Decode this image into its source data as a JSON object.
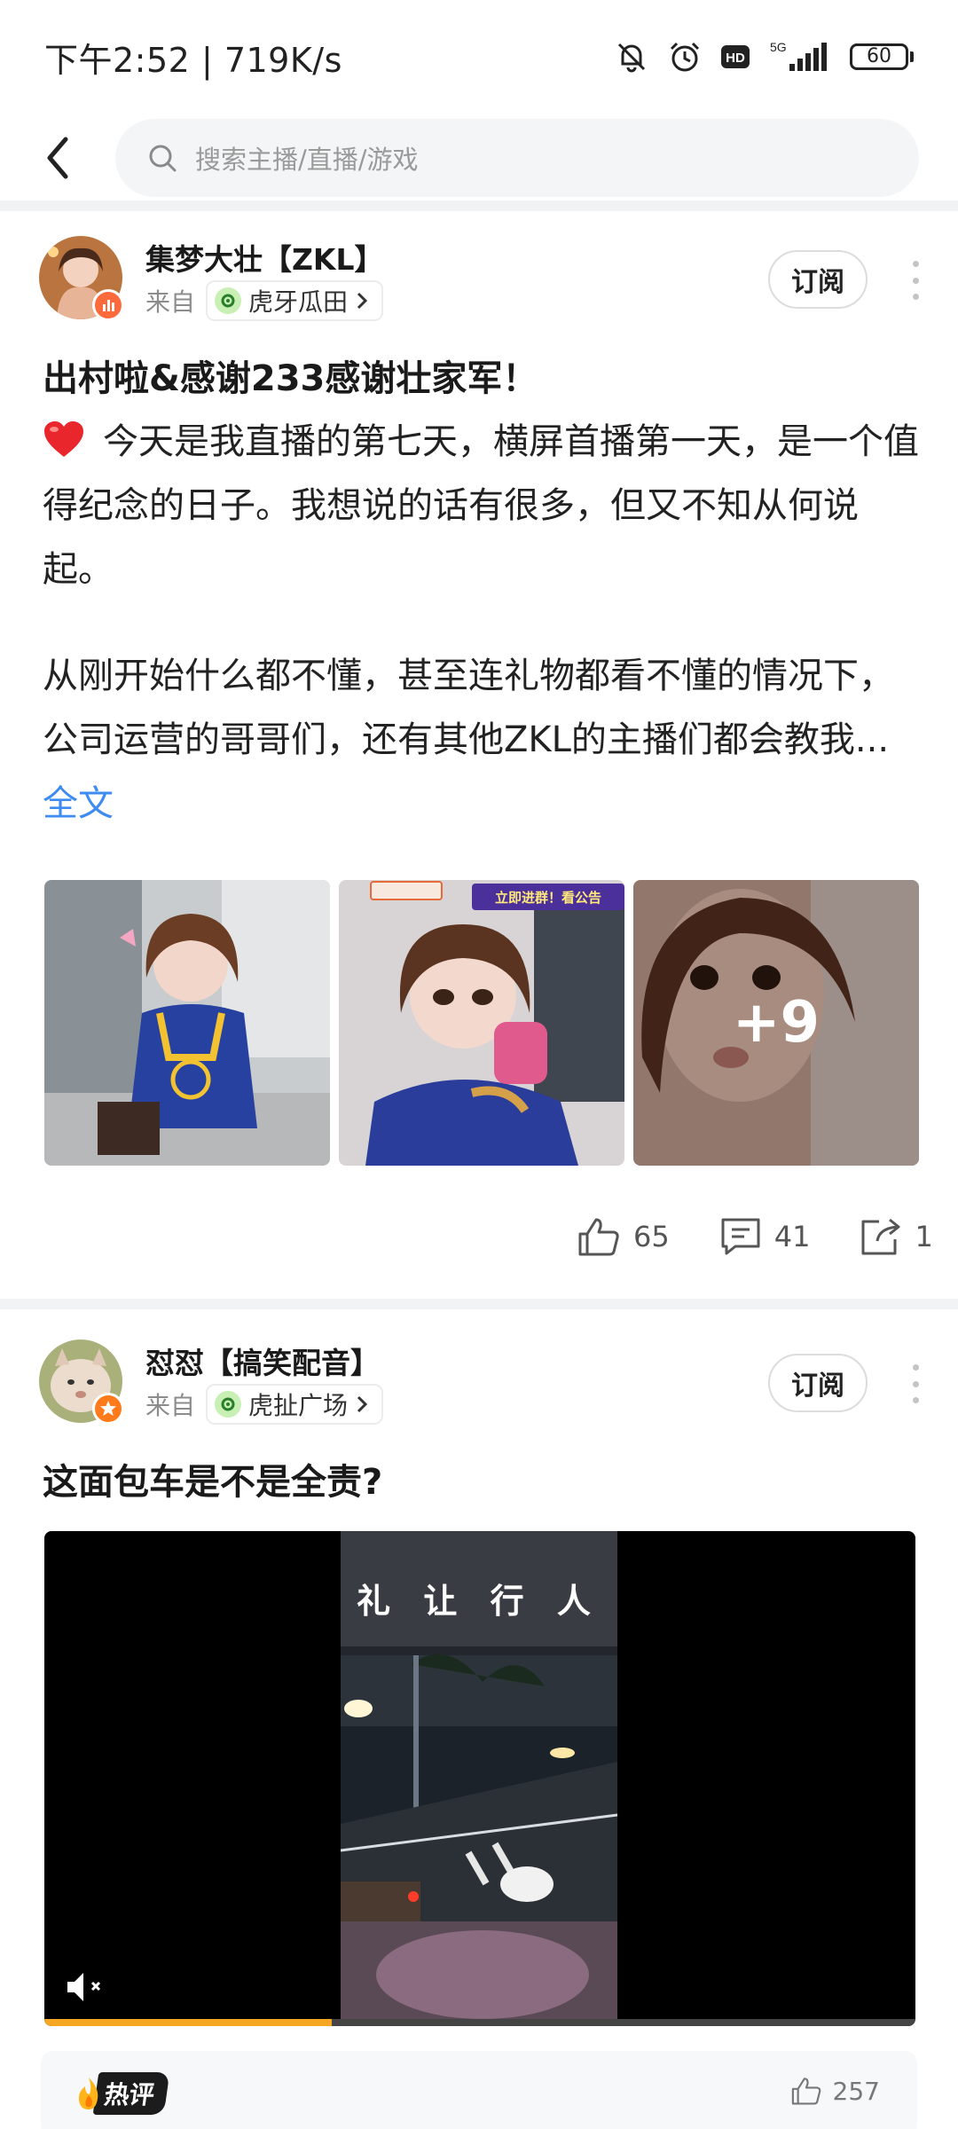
{
  "status_bar": {
    "time": "下午2:52",
    "net_speed": "719K/s",
    "icons": [
      "bell-muted-icon",
      "alarm-icon",
      "hd-icon",
      "5g-signal-icon",
      "battery-icon"
    ],
    "network": "5G",
    "battery": "60"
  },
  "search": {
    "placeholder": "搜索主播/直播/游戏"
  },
  "posts": [
    {
      "author": "集梦大壮【ZKL】",
      "from_label": "来自",
      "source": "虎牙瓜田",
      "subscribe_label": "订阅",
      "title": "出村啦&感谢233感谢壮家军！",
      "body_p1": "今天是我直播的第七天，横屏首播第一天，是一个值得纪念的日子。我想说的话有很多，但又不知从何说起。",
      "body_p2": "从刚开始什么都不懂，甚至连礼物都看不懂的情况下，公司运营的哥哥们，还有其他ZKL的主播们都会教我...",
      "read_more": "全文",
      "images_more": "+9",
      "image_banner_text": "立即进群！看公告",
      "likes": "65",
      "comments": "41",
      "shares": "1"
    },
    {
      "author": "怼怼【搞笑配音】",
      "from_label": "来自",
      "source": "虎扯广场",
      "subscribe_label": "订阅",
      "title": "这面包车是不是全责?",
      "video_caption": "礼 让 行 人",
      "video_progress": 0.33,
      "hot_comment_label": "热评",
      "hot_comment_likes": "257"
    }
  ],
  "colors": {
    "accent_link": "#3e8cf2",
    "progress": "#f5a623",
    "divider": "#f2f3f5"
  }
}
